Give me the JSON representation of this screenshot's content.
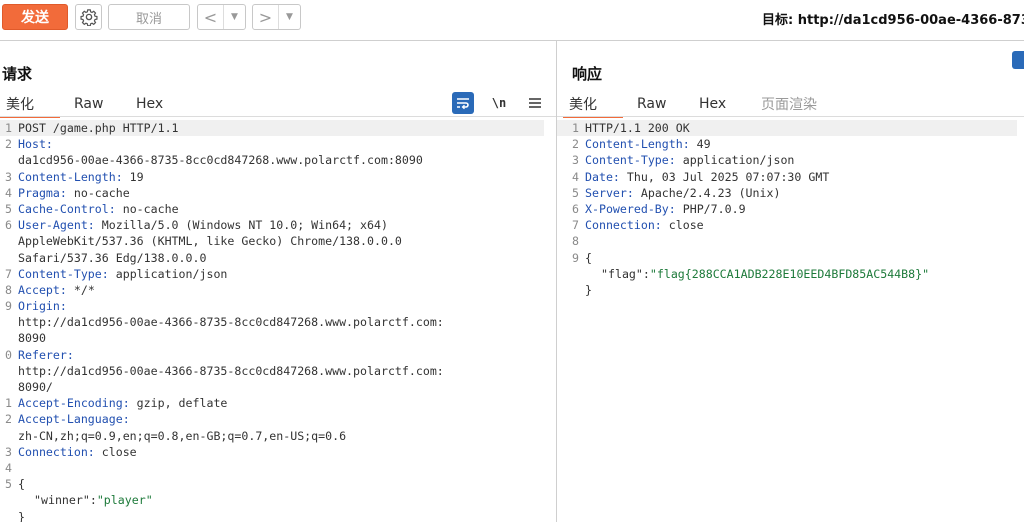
{
  "toolbar": {
    "send_label": "发送",
    "cancel_label": "取消",
    "back_glyph": "<",
    "forward_glyph": ">",
    "dropdown_glyph": "▼",
    "target_text": "目标: http://da1cd956-00ae-4366-873"
  },
  "request": {
    "title": "请求",
    "tabs": [
      "美化",
      "Raw",
      "Hex"
    ],
    "active_tab": "美化",
    "icons": [
      "wrap-icon",
      "newline-icon",
      "menu-icon"
    ],
    "newline_label": "\\n",
    "lines": [
      {
        "num": "1",
        "key": "",
        "value": "POST /game.php HTTP/1.1",
        "highlight": true
      },
      {
        "num": "2",
        "key": "Host:",
        "value": ""
      },
      {
        "num": "",
        "key": "",
        "value": "da1cd956-00ae-4366-8735-8cc0cd847268.www.polarctf.com:8090"
      },
      {
        "num": "3",
        "key": "Content-Length:",
        "value": " 19"
      },
      {
        "num": "4",
        "key": "Pragma:",
        "value": " no-cache"
      },
      {
        "num": "5",
        "key": "Cache-Control:",
        "value": " no-cache"
      },
      {
        "num": "6",
        "key": "User-Agent:",
        "value": " Mozilla/5.0 (Windows NT 10.0; Win64; x64)"
      },
      {
        "num": "",
        "key": "",
        "value": "AppleWebKit/537.36 (KHTML, like Gecko) Chrome/138.0.0.0"
      },
      {
        "num": "",
        "key": "",
        "value": "Safari/537.36 Edg/138.0.0.0"
      },
      {
        "num": "7",
        "key": "Content-Type:",
        "value": " application/json"
      },
      {
        "num": "8",
        "key": "Accept:",
        "value": " */*"
      },
      {
        "num": "9",
        "key": "Origin:",
        "value": ""
      },
      {
        "num": "",
        "key": "",
        "value": "http://da1cd956-00ae-4366-8735-8cc0cd847268.www.polarctf.com:"
      },
      {
        "num": "",
        "key": "",
        "value": "8090"
      },
      {
        "num": "0",
        "key": "Referer:",
        "value": ""
      },
      {
        "num": "",
        "key": "",
        "value": "http://da1cd956-00ae-4366-8735-8cc0cd847268.www.polarctf.com:"
      },
      {
        "num": "",
        "key": "",
        "value": "8090/"
      },
      {
        "num": "1",
        "key": "Accept-Encoding:",
        "value": " gzip, deflate"
      },
      {
        "num": "2",
        "key": "Accept-Language:",
        "value": ""
      },
      {
        "num": "",
        "key": "",
        "value": "zh-CN,zh;q=0.9,en;q=0.8,en-GB;q=0.7,en-US;q=0.6"
      },
      {
        "num": "3",
        "key": "Connection:",
        "value": " close"
      },
      {
        "num": "4",
        "key": "",
        "value": ""
      },
      {
        "num": "5",
        "key": "",
        "value": "{"
      },
      {
        "num": "",
        "key": "",
        "value": "",
        "json_key": "\"winner\"",
        "json_sep": ":",
        "json_val": "\"player\""
      },
      {
        "num": "",
        "key": "",
        "value": "}"
      }
    ]
  },
  "response": {
    "title": "响应",
    "tabs": [
      "美化",
      "Raw",
      "Hex",
      "页面渲染"
    ],
    "active_tab": "美化",
    "lines": [
      {
        "num": "1",
        "key": "",
        "value": "HTTP/1.1 200 OK",
        "highlight": true
      },
      {
        "num": "2",
        "key": "Content-Length:",
        "value": " 49"
      },
      {
        "num": "3",
        "key": "Content-Type:",
        "value": " application/json"
      },
      {
        "num": "4",
        "key": "Date:",
        "value": " Thu, 03 Jul 2025 07:07:30 GMT"
      },
      {
        "num": "5",
        "key": "Server:",
        "value": " Apache/2.4.23 (Unix)"
      },
      {
        "num": "6",
        "key": "X-Powered-By:",
        "value": " PHP/7.0.9"
      },
      {
        "num": "7",
        "key": "Connection:",
        "value": " close"
      },
      {
        "num": "8",
        "key": "",
        "value": ""
      },
      {
        "num": "9",
        "key": "",
        "value": "{"
      },
      {
        "num": "",
        "key": "",
        "value": "",
        "json_key": "\"flag\"",
        "json_sep": ":",
        "json_val": "\"flag{288CCA1ADB228E10EED4BFD85AC544B8}\""
      },
      {
        "num": "",
        "key": "",
        "value": "}"
      }
    ]
  },
  "colors": {
    "accent": "#f26b3a",
    "header_key": "#2250b0",
    "json_value": "#1d7a3a",
    "icon_blue": "#2a6ab8"
  }
}
